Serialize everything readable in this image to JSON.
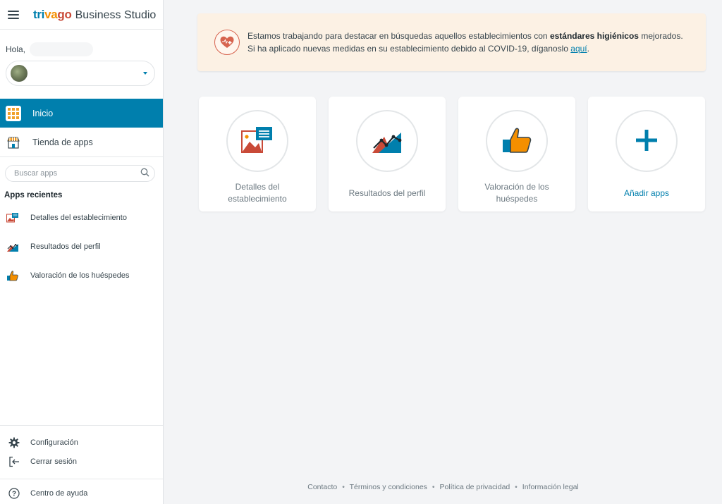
{
  "app": {
    "brand_word": "trivago",
    "product_name": "Business Studio"
  },
  "sidebar": {
    "greeting": "Hola,",
    "nav": [
      {
        "label": "Inicio",
        "icon": "apps-grid-icon",
        "active": true
      },
      {
        "label": "Tienda de apps",
        "icon": "app-store-icon",
        "active": false
      }
    ],
    "search_placeholder": "Buscar apps",
    "recent_title": "Apps recientes",
    "recent_apps": [
      {
        "label": "Detalles del establecimiento",
        "icon": "property-details-icon"
      },
      {
        "label": "Resultados del perfil",
        "icon": "profile-results-icon"
      },
      {
        "label": "Valoración de los huéspedes",
        "icon": "guest-rating-icon"
      }
    ],
    "bottom": [
      {
        "label": "Configuración",
        "icon": "gear-icon"
      },
      {
        "label": "Cerrar sesión",
        "icon": "logout-icon"
      }
    ],
    "help": {
      "label": "Centro de ayuda",
      "icon": "help-icon"
    }
  },
  "banner": {
    "text_before": "Estamos trabajando para destacar en búsquedas aquellos establecimientos con ",
    "text_bold": "estándares higiénicos",
    "text_after": " mejorados. Si ha aplicado nuevas medidas en su establecimiento debido al COVID-19, díganoslo ",
    "link": "aquí",
    "text_end": "."
  },
  "cards": [
    {
      "label": "Detalles del establecimiento",
      "icon": "property-details-icon"
    },
    {
      "label": "Resultados del perfil",
      "icon": "profile-results-icon"
    },
    {
      "label": "Valoración de los huéspedes",
      "icon": "guest-rating-icon"
    },
    {
      "label": "Añadir apps",
      "icon": "plus-icon"
    }
  ],
  "footer": {
    "links": [
      "Contacto",
      "Términos y condiciones",
      "Política de privacidad",
      "Información legal"
    ],
    "separator": "•"
  },
  "colors": {
    "accent": "#007fad",
    "brand_orange": "#f48f00",
    "brand_red": "#c94a38",
    "banner_bg": "#fcf1e4",
    "page_bg": "#f3f4f6"
  }
}
